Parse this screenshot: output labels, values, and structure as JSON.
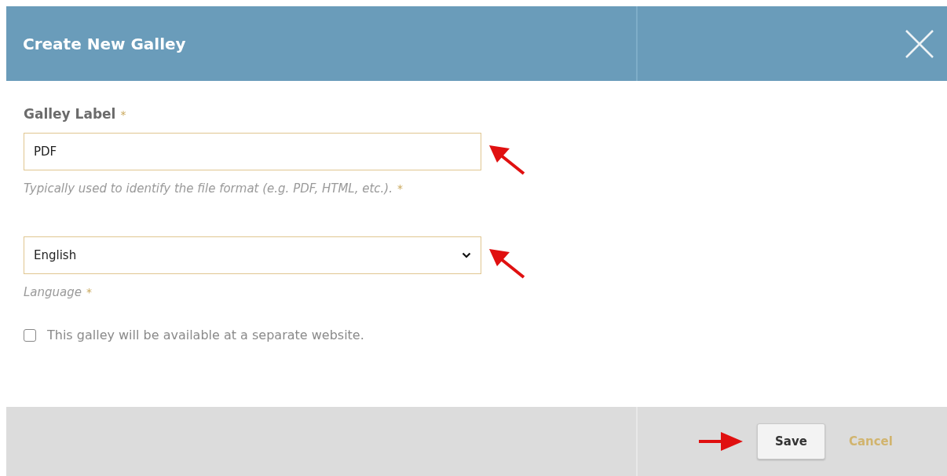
{
  "dialog": {
    "title": "Create New Galley"
  },
  "fields": [
    {
      "kind": "text",
      "label": "Galley Label",
      "label_mark": "*",
      "value": "PDF",
      "description": "Typically used to identify the file format (e.g. PDF, HTML, etc.).",
      "description_mark": "*"
    },
    {
      "kind": "select",
      "value": "English",
      "description": "Language",
      "description_mark": "*"
    }
  ],
  "checkbox": {
    "label": "This galley will be available at a separate website.",
    "checked": false
  },
  "buttons": {
    "save": "Save",
    "cancel": "Cancel"
  }
}
